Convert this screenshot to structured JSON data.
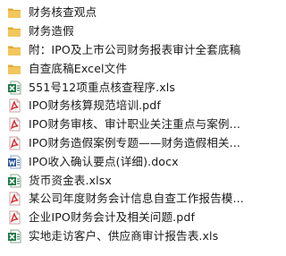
{
  "items": [
    {
      "icon": "folder-icon",
      "type": "folder",
      "name": "财务核查观点"
    },
    {
      "icon": "folder-icon",
      "type": "folder",
      "name": "财务造假"
    },
    {
      "icon": "folder-icon",
      "type": "folder",
      "name": "附：IPO及上市公司财务报表审计全套底稿"
    },
    {
      "icon": "folder-icon",
      "type": "folder",
      "name": "自查底稿Excel文件"
    },
    {
      "icon": "excel-file-icon",
      "type": "xls",
      "name": "551号12项重点核查程序.xls"
    },
    {
      "icon": "pdf-file-icon",
      "type": "pdf",
      "name": "IPO财务核算规范培训.pdf"
    },
    {
      "icon": "pdf-file-icon",
      "type": "pdf",
      "name": "IPO财务审核、审计职业关注重点与案例..."
    },
    {
      "icon": "pdf-file-icon",
      "type": "pdf",
      "name": "IPO财务造假案例专题——财务造假相关..."
    },
    {
      "icon": "word-file-icon",
      "type": "docx",
      "name": "IPO收入确认要点(详细).docx"
    },
    {
      "icon": "excel-file-icon",
      "type": "xlsx",
      "name": "货币资金表.xlsx"
    },
    {
      "icon": "pdf-file-icon",
      "type": "pdf",
      "name": "某公司年度财务会计信息自查工作报告模..."
    },
    {
      "icon": "pdf-file-icon",
      "type": "pdf",
      "name": "企业IPO财务会计及相关问题.pdf"
    },
    {
      "icon": "excel-file-icon",
      "type": "xls",
      "name": "实地走访客户、供应商审计报告表.xls"
    }
  ],
  "colors": {
    "folder": "#f2c65a",
    "folder_dark": "#e1ad35",
    "excel": "#1f7a45",
    "pdf": "#d72d2d",
    "word": "#2b579a"
  }
}
